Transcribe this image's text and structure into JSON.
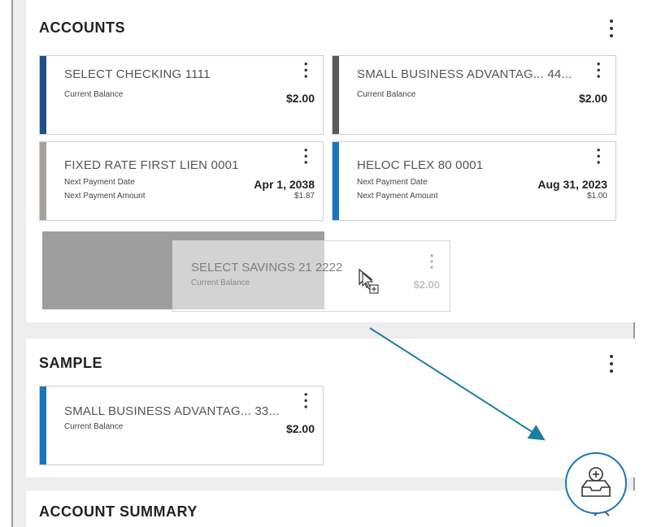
{
  "accounts": {
    "title": "ACCOUNTS",
    "cards": [
      {
        "name": "SELECT CHECKING 1111",
        "label1": "Current Balance",
        "value1": "$2.00",
        "color": "#1f4e8c"
      },
      {
        "name": "SMALL BUSINESS ADVANTAG... 44...",
        "label1": "Current Balance",
        "value1": "$2.00",
        "color": "#5a5a5a"
      },
      {
        "name": "FIXED RATE FIRST LIEN 0001",
        "label1": "Next Payment Date",
        "value1": "Apr 1, 2038",
        "label2": "Next Payment Amount",
        "value2": "$1.87",
        "color": "#a7a19b"
      },
      {
        "name": "HELOC FLEX 80 0001",
        "label1": "Next Payment Date",
        "value1": "Aug 31, 2023",
        "label2": "Next Payment Amount",
        "value2": "$1.00",
        "color": "#1a74c0"
      }
    ],
    "dragging": {
      "name": "SELECT SAVINGS 21 2222",
      "label1": "Current Balance",
      "value1": "$2.00"
    }
  },
  "sample": {
    "title": "SAMPLE",
    "cards": [
      {
        "name": "SMALL BUSINESS ADVANTAG... 33...",
        "label1": "Current Balance",
        "value1": "$2.00",
        "color": "#1a74c0"
      }
    ]
  },
  "summary": {
    "title": "ACCOUNT SUMMARY"
  },
  "icons": {
    "fab": "tray-add-icon",
    "menu": "kebab-menu-icon",
    "cursor": "drag-copy-cursor-icon",
    "chevron": "chevron-up-icon"
  },
  "colors": {
    "accent": "#1a74b8",
    "arrow": "#1a7fa0"
  }
}
